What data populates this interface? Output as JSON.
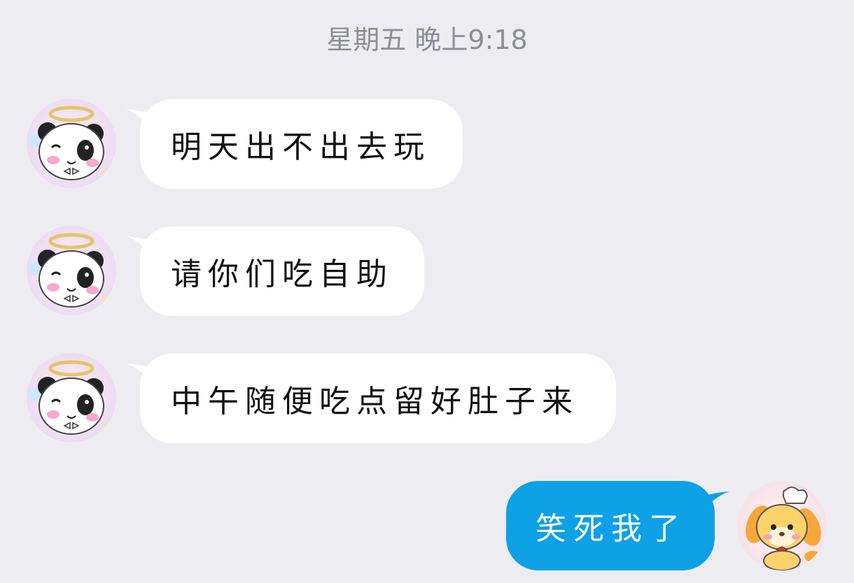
{
  "timestamp": "星期五 晚上9:18",
  "messages": [
    {
      "side": "received",
      "text": "明天出不出去玩",
      "avatar": "panda-angel-avatar"
    },
    {
      "side": "received",
      "text": "请你们吃自助",
      "avatar": "panda-angel-avatar"
    },
    {
      "side": "received",
      "text": "中午随便吃点留好肚子来",
      "avatar": "panda-angel-avatar"
    },
    {
      "side": "sent",
      "text": "笑死我了",
      "avatar": "chef-puppy-avatar"
    }
  ],
  "colors": {
    "background": "#ededf1",
    "received_bubble": "#ffffff",
    "sent_bubble": "#0ea1e6",
    "timestamp_text": "#8d8d96"
  }
}
